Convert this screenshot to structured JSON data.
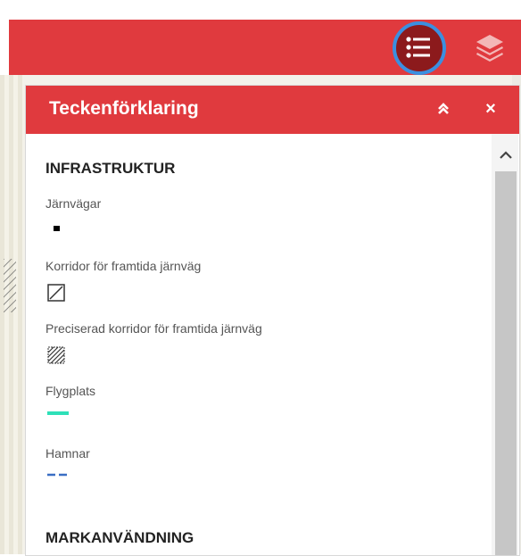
{
  "toolbar": {
    "legend_icon": "list-icon",
    "layers_icon": "layers-icon",
    "highlight_color": "#3b8fe0",
    "brand_color": "#e03a3e"
  },
  "legend_panel": {
    "title": "Teckenförklaring",
    "collapse_icon": "double-chevron-up-icon",
    "close_label": "×",
    "sections": [
      {
        "title": "INFRASTRUKTUR",
        "items": [
          {
            "label": "Järnvägar",
            "symbol": "black-dot"
          },
          {
            "label": "Korridor för framtida järnväg",
            "symbol": "hatched-square"
          },
          {
            "label": "Preciserad korridor för framtida järnväg",
            "symbol": "dense-hatched-square"
          },
          {
            "label": "Flygplats",
            "symbol": "turquoise-line",
            "color": "#2ee0b8"
          },
          {
            "label": "Hamnar",
            "symbol": "blue-dashed-line",
            "color": "#3a6fc4"
          }
        ]
      },
      {
        "title": "MARKANVÄNDNING",
        "items": []
      }
    ]
  }
}
